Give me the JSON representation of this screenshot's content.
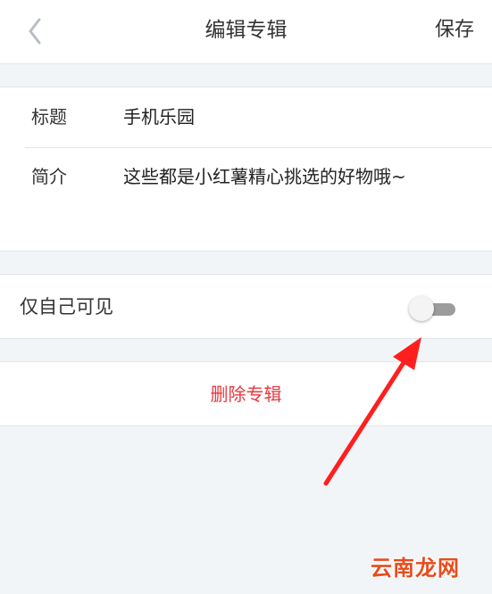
{
  "header": {
    "title": "编辑专辑",
    "save_label": "保存",
    "back_icon": "chevron-left-icon"
  },
  "album": {
    "title_label": "标题",
    "title_value": "手机乐园",
    "intro_label": "简介",
    "intro_value": "这些都是小红薯精心挑选的好物哦~"
  },
  "privacy": {
    "label": "仅自己可见",
    "enabled": false
  },
  "actions": {
    "delete_label": "删除专辑"
  },
  "annotation": {
    "arrow_color": "#ff1f1f",
    "points_to": "privacy-toggle"
  },
  "watermark": {
    "text": "云南龙网"
  },
  "colors": {
    "page_background": "#f2f5f8",
    "delete_text": "#e8383d",
    "toggle_track_off": "#9c9c9c"
  }
}
